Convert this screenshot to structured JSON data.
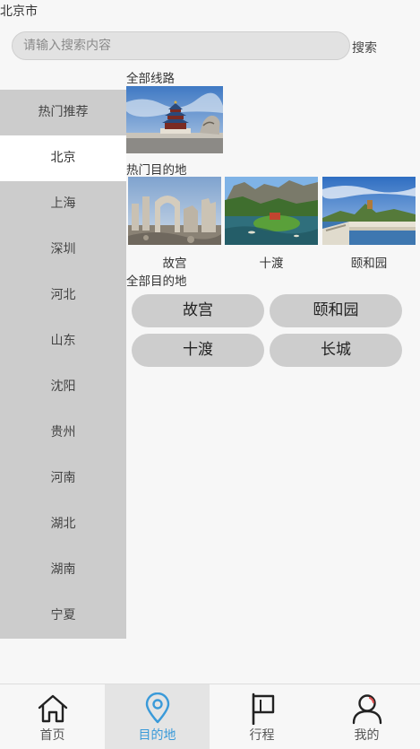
{
  "header": {
    "city": "北京市"
  },
  "search": {
    "placeholder": "请输入搜索内容",
    "button": "搜索"
  },
  "sidebar": {
    "items": [
      "热门推荐",
      "北京",
      "上海",
      "深圳",
      "河北",
      "山东",
      "沈阳",
      "贵州",
      "河南",
      "湖北",
      "湖南",
      "宁夏"
    ],
    "active": "北京"
  },
  "sections": {
    "all_routes": "全部线路",
    "hot_destinations": "热门目的地",
    "all_destinations": "全部目的地"
  },
  "hot": [
    "故宫",
    "十渡",
    "颐和园"
  ],
  "all_dest": [
    "故宫",
    "颐和园",
    "十渡",
    "长城"
  ],
  "tabs": [
    {
      "label": "首页",
      "icon": "home-icon"
    },
    {
      "label": "目的地",
      "icon": "location-pin-icon",
      "active": true
    },
    {
      "label": "行程",
      "icon": "flag-icon"
    },
    {
      "label": "我的",
      "icon": "user-icon"
    }
  ],
  "colors": {
    "active_tab_text": "#3a9ad9",
    "sidebar_bg": "#cccccc",
    "pill_bg": "#cdcdcd"
  }
}
